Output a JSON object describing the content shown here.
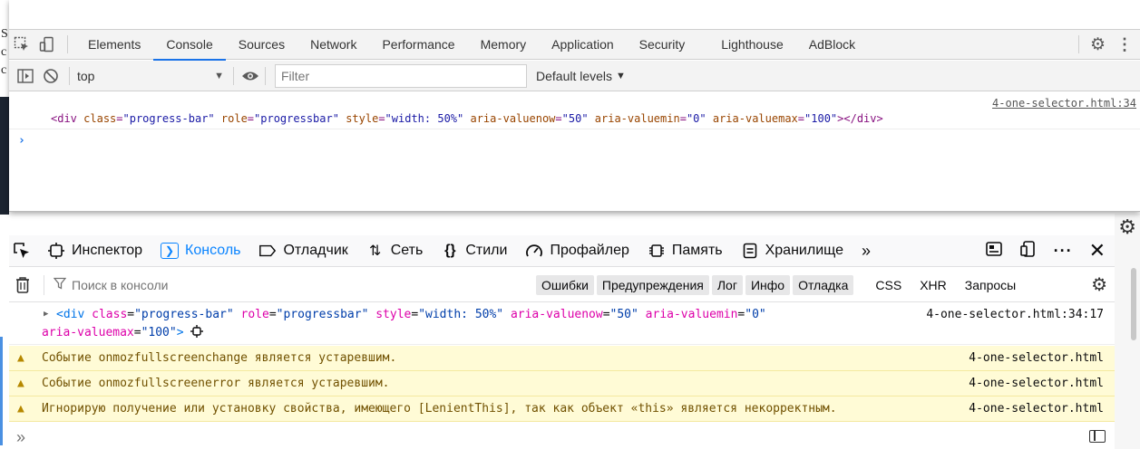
{
  "background": {
    "letters": [
      "S",
      "с",
      "с"
    ]
  },
  "chrome": {
    "tabs": [
      "Elements",
      "Console",
      "Sources",
      "Network",
      "Performance",
      "Memory",
      "Application",
      "Security",
      "Lighthouse",
      "AdBlock"
    ],
    "active_tab": "Console",
    "context": "top",
    "filter_placeholder": "Filter",
    "levels_label": "Default levels",
    "source_link": "4-one-selector.html:34",
    "log_line": {
      "open": "<div",
      "attrs": [
        {
          "name": "class",
          "value": "\"progress-bar\""
        },
        {
          "name": "role",
          "value": "\"progressbar\""
        },
        {
          "name": "style",
          "value": "\"width: 50%\""
        },
        {
          "name": "aria-valuenow",
          "value": "\"50\""
        },
        {
          "name": "aria-valuemin",
          "value": "\"0\""
        },
        {
          "name": "aria-valuemax",
          "value": "\"100\""
        }
      ],
      "close": "></div>"
    },
    "prompt": "›"
  },
  "firefox": {
    "tabs": [
      {
        "label": "Инспектор",
        "icon": "inspector-icon"
      },
      {
        "label": "Консоль",
        "icon": "console-icon"
      },
      {
        "label": "Отладчик",
        "icon": "debugger-icon"
      },
      {
        "label": "Сеть",
        "icon": "network-icon"
      },
      {
        "label": "Стили",
        "icon": "style-editor-icon"
      },
      {
        "label": "Профайлер",
        "icon": "profiler-icon"
      },
      {
        "label": "Память",
        "icon": "memory-icon"
      },
      {
        "label": "Хранилище",
        "icon": "storage-icon"
      }
    ],
    "active_tab": "Консоль",
    "search_placeholder": "Поиск в консоли",
    "levels": [
      "Ошибки",
      "Предупреждения",
      "Лог",
      "Инфо",
      "Отладка"
    ],
    "request_filters": [
      "CSS",
      "XHR",
      "Запросы"
    ],
    "log": {
      "line1_open": "<div",
      "line1_attrs": [
        {
          "name": "class",
          "value": "\"progress-bar\""
        },
        {
          "name": "role",
          "value": "\"progressbar\""
        },
        {
          "name": "style",
          "value": "\"width: 50%\""
        },
        {
          "name": "aria-valuenow",
          "value": "\"50\""
        },
        {
          "name": "aria-valuemin",
          "value": "\"0\""
        }
      ],
      "line2_attr": {
        "name": "aria-valuemax",
        "value": "\"100\""
      },
      "line2_close": ">",
      "source": "4-one-selector.html:34:17"
    },
    "warnings": [
      {
        "text": "Событие onmozfullscreenchange является устаревшим.",
        "source": "4-one-selector.html"
      },
      {
        "text": "Событие onmozfullscreenerror является устаревшим.",
        "source": "4-one-selector.html"
      },
      {
        "text": "Игнорирую получение или установку свойства, имеющего [LenientThis], так как объект «this» является некорректным.",
        "source": "4-one-selector.html"
      }
    ],
    "prompt": "»"
  }
}
